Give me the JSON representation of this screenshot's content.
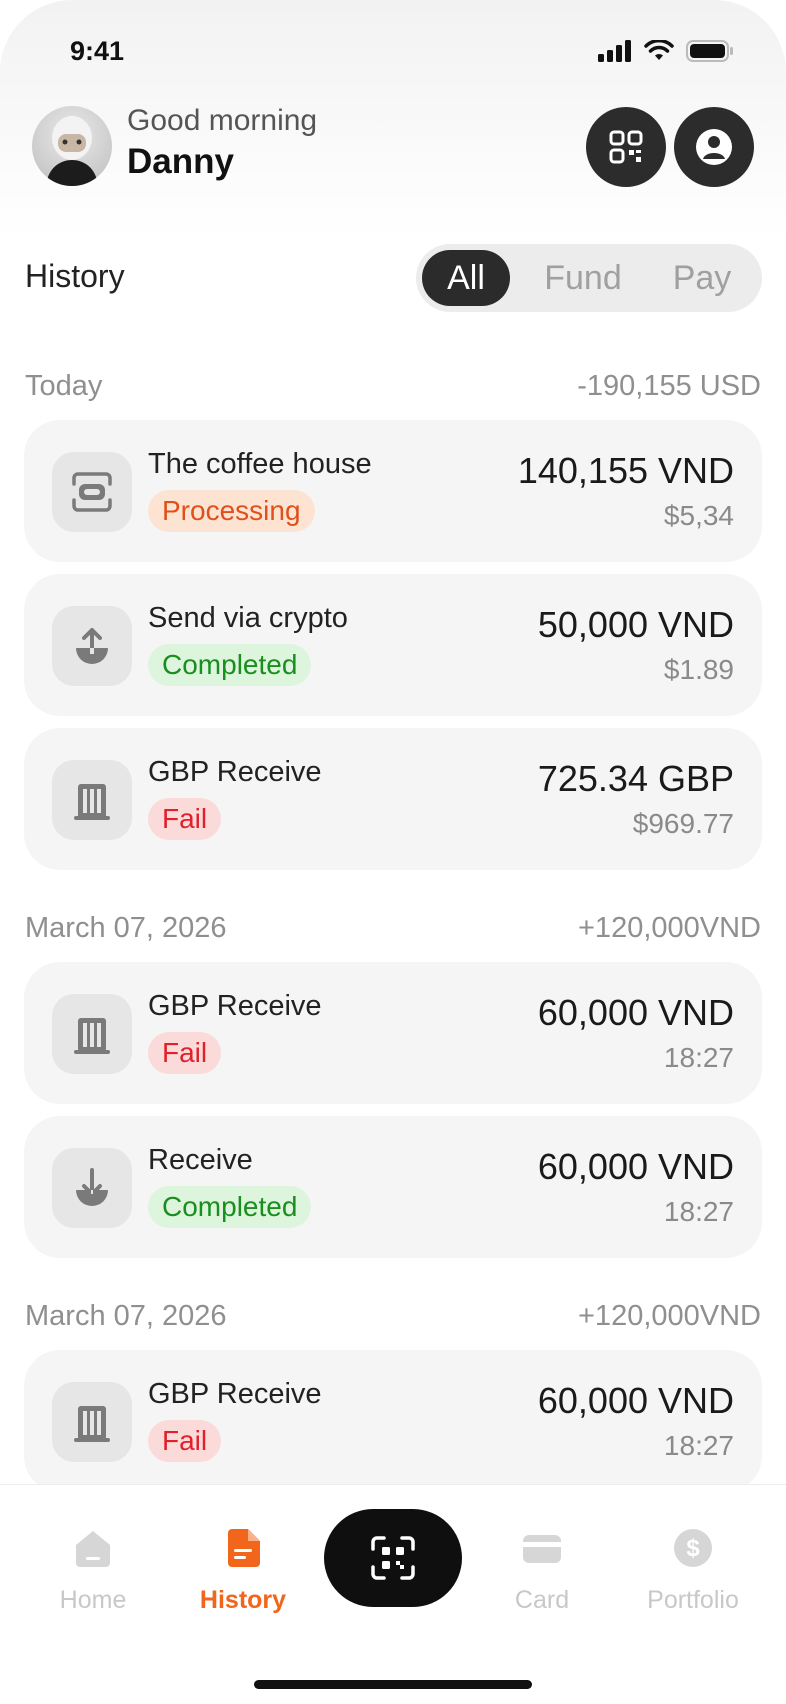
{
  "status_bar": {
    "time": "9:41"
  },
  "header": {
    "greeting": "Good morning",
    "name": "Danny",
    "qr_button_icon": "qr-code-icon",
    "profile_button_icon": "user-circle-icon"
  },
  "history": {
    "title": "History",
    "filters": [
      "All",
      "Fund",
      "Pay"
    ],
    "active_filter": "All"
  },
  "sections": [
    {
      "date": "Today",
      "total": "-190,155 USD",
      "transactions": [
        {
          "icon": "scan-icon",
          "name": "The coffee house",
          "status": "Processing",
          "amount": "140,155 VND",
          "sub": "$5,34"
        },
        {
          "icon": "upload-icon",
          "name": "Send via crypto",
          "status": "Completed",
          "amount": "50,000 VND",
          "sub": "$1.89"
        },
        {
          "icon": "bank-icon",
          "name": "GBP Receive",
          "status": "Fail",
          "amount": "725.34 GBP",
          "sub": "$969.77"
        }
      ]
    },
    {
      "date": "March 07, 2026",
      "total": "+120,000VND",
      "transactions": [
        {
          "icon": "bank-icon",
          "name": "GBP Receive",
          "status": "Fail",
          "amount": "60,000 VND",
          "sub": "18:27"
        },
        {
          "icon": "download-icon",
          "name": "Receive",
          "status": "Completed",
          "amount": "60,000 VND",
          "sub": "18:27"
        }
      ]
    },
    {
      "date": "March 07, 2026",
      "total": "+120,000VND",
      "transactions": [
        {
          "icon": "bank-icon",
          "name": "GBP Receive",
          "status": "Fail",
          "amount": "60,000 VND",
          "sub": "18:27"
        }
      ]
    }
  ],
  "nav": {
    "items": [
      "Home",
      "History",
      "Card",
      "Portfolio"
    ],
    "active": "History",
    "center_icon": "scan-icon"
  },
  "colors": {
    "accent": "#f2661b",
    "dark": "#2b2b2b",
    "processing": "#e0501a",
    "completed": "#1a8e1f",
    "fail": "#e0202b"
  }
}
